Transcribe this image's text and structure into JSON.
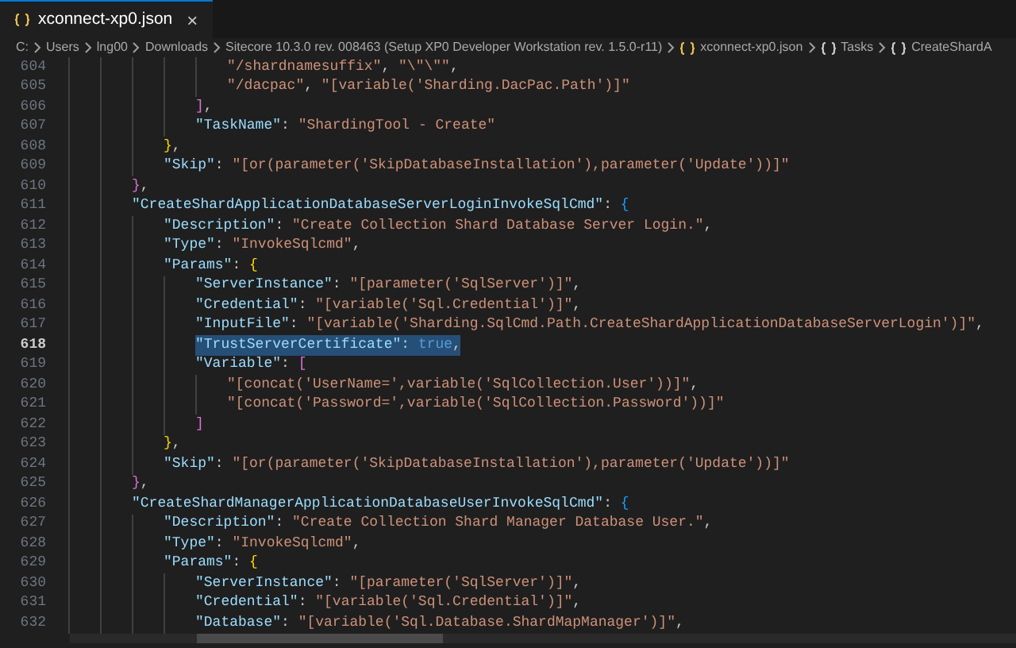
{
  "tabs": [
    {
      "label": "xconnect-xp0.json",
      "selected": true,
      "close": "×"
    }
  ],
  "breadcrumb": [
    {
      "kind": "folder",
      "label": "C:"
    },
    {
      "kind": "folder",
      "label": "Users"
    },
    {
      "kind": "folder",
      "label": "lng00"
    },
    {
      "kind": "folder",
      "label": "Downloads"
    },
    {
      "kind": "folder",
      "label": "Sitecore 10.3.0 rev. 008463 (Setup XP0 Developer Workstation rev. 1.5.0-r11)"
    },
    {
      "kind": "file",
      "label": "xconnect-xp0.json"
    },
    {
      "kind": "object",
      "label": "Tasks"
    },
    {
      "kind": "object",
      "label": "CreateShardA"
    }
  ],
  "lines": [
    {
      "children": [
        {
          "children": [
            {
              "children": [
                {
                  "number": "604",
                  "selected": false,
                  "tokens": [
                    {
                      "kind": "string",
                      "text": "\"/shardnamesuffix\""
                    },
                    {
                      "kind": "punct",
                      "text": ", "
                    },
                    {
                      "kind": "string",
                      "text": "\"\\\"\\\"\""
                    },
                    {
                      "kind": "punct",
                      "text": ","
                    }
                  ]
                },
                {
                  "number": "605",
                  "selected": false,
                  "tokens": [
                    {
                      "kind": "string",
                      "text": "\"/dacpac\""
                    },
                    {
                      "kind": "punct",
                      "text": ", "
                    },
                    {
                      "kind": "string",
                      "text": "\"[variable('Sharding.DacPac.Path')]\""
                    }
                  ]
                }
              ]
            },
            {
              "number": "606",
              "selected": false,
              "tokens": [
                {
                  "kind": "bracket",
                  "text": "]",
                  "color": "#da70d6"
                },
                {
                  "kind": "punct",
                  "text": ","
                }
              ]
            },
            {
              "number": "607",
              "selected": false,
              "tokens": [
                {
                  "kind": "key",
                  "text": "\"TaskName\""
                },
                {
                  "kind": "punct",
                  "text": ": "
                },
                {
                  "kind": "string",
                  "text": "\"ShardingTool - Create\""
                }
              ]
            }
          ]
        },
        {
          "number": "608",
          "selected": false,
          "tokens": [
            {
              "kind": "bracket",
              "text": "}",
              "color": "#ffd700"
            },
            {
              "kind": "punct",
              "text": ","
            }
          ]
        },
        {
          "number": "609",
          "selected": false,
          "tokens": [
            {
              "kind": "key",
              "text": "\"Skip\""
            },
            {
              "kind": "punct",
              "text": ": "
            },
            {
              "kind": "string",
              "text": "\"[or(parameter('SkipDatabaseInstallation'),parameter('Update'))]\""
            }
          ]
        }
      ]
    },
    {
      "number": "610",
      "selected": false,
      "tokens": [
        {
          "kind": "bracket",
          "text": "}",
          "color": "#da70d6"
        },
        {
          "kind": "punct",
          "text": ","
        }
      ]
    },
    {
      "number": "611",
      "selected": false,
      "tokens": [
        {
          "kind": "key",
          "text": "\"CreateShardApplicationDatabaseServerLoginInvokeSqlCmd\""
        },
        {
          "kind": "punct",
          "text": ": "
        },
        {
          "kind": "bracket",
          "text": "{",
          "color": "#179fff"
        }
      ],
      "children": [
        {
          "number": "612",
          "selected": false,
          "tokens": [
            {
              "kind": "key",
              "text": "\"Description\""
            },
            {
              "kind": "punct",
              "text": ": "
            },
            {
              "kind": "string",
              "text": "\"Create Collection Shard Database Server Login.\""
            },
            {
              "kind": "punct",
              "text": ","
            }
          ]
        },
        {
          "number": "613",
          "selected": false,
          "tokens": [
            {
              "kind": "key",
              "text": "\"Type\""
            },
            {
              "kind": "punct",
              "text": ": "
            },
            {
              "kind": "string",
              "text": "\"InvokeSqlcmd\""
            },
            {
              "kind": "punct",
              "text": ","
            }
          ]
        },
        {
          "number": "614",
          "selected": false,
          "tokens": [
            {
              "kind": "key",
              "text": "\"Params\""
            },
            {
              "kind": "punct",
              "text": ": "
            },
            {
              "kind": "bracket",
              "text": "{",
              "color": "#ffd700"
            }
          ],
          "children": [
            {
              "number": "615",
              "selected": false,
              "tokens": [
                {
                  "kind": "key",
                  "text": "\"ServerInstance\""
                },
                {
                  "kind": "punct",
                  "text": ": "
                },
                {
                  "kind": "string",
                  "text": "\"[parameter('SqlServer')]\""
                },
                {
                  "kind": "punct",
                  "text": ","
                }
              ]
            },
            {
              "number": "616",
              "selected": false,
              "tokens": [
                {
                  "kind": "key",
                  "text": "\"Credential\""
                },
                {
                  "kind": "punct",
                  "text": ": "
                },
                {
                  "kind": "string",
                  "text": "\"[variable('Sql.Credential')]\""
                },
                {
                  "kind": "punct",
                  "text": ","
                }
              ]
            },
            {
              "number": "617",
              "selected": false,
              "tokens": [
                {
                  "kind": "key",
                  "text": "\"InputFile\""
                },
                {
                  "kind": "punct",
                  "text": ": "
                },
                {
                  "kind": "string",
                  "text": "\"[variable('Sharding.SqlCmd.Path.CreateShardApplicationDatabaseServerLogin')]\""
                },
                {
                  "kind": "punct",
                  "text": ","
                }
              ]
            },
            {
              "number": "618",
              "selected": true,
              "tokens": [
                {
                  "kind": "key",
                  "text": "\"TrustServerCertificate\""
                },
                {
                  "kind": "punct",
                  "text": ": "
                },
                {
                  "kind": "keyword",
                  "text": "true"
                },
                {
                  "kind": "punct",
                  "text": ","
                }
              ]
            },
            {
              "number": "619",
              "selected": false,
              "tokens": [
                {
                  "kind": "key",
                  "text": "\"Variable\""
                },
                {
                  "kind": "punct",
                  "text": ": "
                },
                {
                  "kind": "bracket",
                  "text": "[",
                  "color": "#da70d6"
                }
              ],
              "children": [
                {
                  "number": "620",
                  "selected": false,
                  "tokens": [
                    {
                      "kind": "string",
                      "text": "\"[concat('UserName=',variable('SqlCollection.User'))]\""
                    },
                    {
                      "kind": "punct",
                      "text": ","
                    }
                  ]
                },
                {
                  "number": "621",
                  "selected": false,
                  "tokens": [
                    {
                      "kind": "string",
                      "text": "\"[concat('Password=',variable('SqlCollection.Password'))]\""
                    }
                  ]
                }
              ]
            },
            {
              "number": "622",
              "selected": false,
              "tokens": [
                {
                  "kind": "bracket",
                  "text": "]",
                  "color": "#da70d6"
                }
              ]
            }
          ]
        },
        {
          "number": "623",
          "selected": false,
          "tokens": [
            {
              "kind": "bracket",
              "text": "}",
              "color": "#ffd700"
            },
            {
              "kind": "punct",
              "text": ","
            }
          ]
        },
        {
          "number": "624",
          "selected": false,
          "tokens": [
            {
              "kind": "key",
              "text": "\"Skip\""
            },
            {
              "kind": "punct",
              "text": ": "
            },
            {
              "kind": "string",
              "text": "\"[or(parameter('SkipDatabaseInstallation'),parameter('Update'))]\""
            }
          ]
        }
      ]
    },
    {
      "number": "625",
      "selected": false,
      "tokens": [
        {
          "kind": "bracket",
          "text": "}",
          "color": "#da70d6"
        },
        {
          "kind": "punct",
          "text": ","
        }
      ]
    },
    {
      "number": "626",
      "selected": false,
      "tokens": [
        {
          "kind": "key",
          "text": "\"CreateShardManagerApplicationDatabaseUserInvokeSqlCmd\""
        },
        {
          "kind": "punct",
          "text": ": "
        },
        {
          "kind": "bracket",
          "text": "{",
          "color": "#179fff"
        }
      ],
      "children": [
        {
          "number": "627",
          "selected": false,
          "tokens": [
            {
              "kind": "key",
              "text": "\"Description\""
            },
            {
              "kind": "punct",
              "text": ": "
            },
            {
              "kind": "string",
              "text": "\"Create Collection Shard Manager Database User.\""
            },
            {
              "kind": "punct",
              "text": ","
            }
          ]
        },
        {
          "number": "628",
          "selected": false,
          "tokens": [
            {
              "kind": "key",
              "text": "\"Type\""
            },
            {
              "kind": "punct",
              "text": ": "
            },
            {
              "kind": "string",
              "text": "\"InvokeSqlcmd\""
            },
            {
              "kind": "punct",
              "text": ","
            }
          ]
        },
        {
          "number": "629",
          "selected": false,
          "tokens": [
            {
              "kind": "key",
              "text": "\"Params\""
            },
            {
              "kind": "punct",
              "text": ": "
            },
            {
              "kind": "bracket",
              "text": "{",
              "color": "#ffd700"
            }
          ],
          "children": [
            {
              "number": "630",
              "selected": false,
              "tokens": [
                {
                  "kind": "key",
                  "text": "\"ServerInstance\""
                },
                {
                  "kind": "punct",
                  "text": ": "
                },
                {
                  "kind": "string",
                  "text": "\"[parameter('SqlServer')]\""
                },
                {
                  "kind": "punct",
                  "text": ","
                }
              ]
            },
            {
              "number": "631",
              "selected": false,
              "tokens": [
                {
                  "kind": "key",
                  "text": "\"Credential\""
                },
                {
                  "kind": "punct",
                  "text": ": "
                },
                {
                  "kind": "string",
                  "text": "\"[variable('Sql.Credential')]\""
                },
                {
                  "kind": "punct",
                  "text": ","
                }
              ]
            },
            {
              "number": "632",
              "selected": false,
              "tokens": [
                {
                  "kind": "key",
                  "text": "\"Database\""
                },
                {
                  "kind": "punct",
                  "text": ": "
                },
                {
                  "kind": "string",
                  "text": "\"[variable('Sql.Database.ShardMapManager')]\""
                },
                {
                  "kind": "punct",
                  "text": ","
                }
              ]
            }
          ]
        }
      ]
    }
  ]
}
